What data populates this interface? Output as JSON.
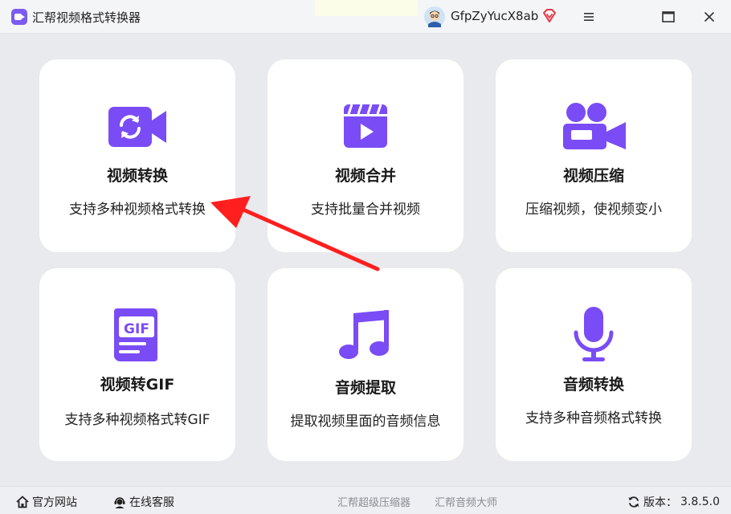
{
  "app": {
    "title": "汇帮视频格式转换器"
  },
  "user": {
    "name": "GfpZyYucX8ab"
  },
  "icons": {
    "app_logo": "video-app-logo",
    "avatar": "cartoon-avatar",
    "vip": "diamond-vip-icon",
    "menu": "hamburger-menu-icon",
    "maximize": "maximize-icon",
    "close": "close-icon"
  },
  "colors": {
    "accent": "#7a4cf5",
    "arrow": "#ff1f1f",
    "vip": "#e53946"
  },
  "cards": [
    {
      "title": "视频转换",
      "desc": "支持多种视频格式转换",
      "icon": "video-convert-icon"
    },
    {
      "title": "视频合并",
      "desc": "支持批量合并视频",
      "icon": "video-merge-icon"
    },
    {
      "title": "视频压缩",
      "desc": "压缩视频，使视频变小",
      "icon": "video-compress-icon"
    },
    {
      "title": "视频转GIF",
      "desc": "支持多种视频格式转GIF",
      "icon": "gif-file-icon"
    },
    {
      "title": "音频提取",
      "desc": "提取视频里面的音频信息",
      "icon": "music-note-icon"
    },
    {
      "title": "音频转换",
      "desc": "支持多种音频格式转换",
      "icon": "microphone-icon"
    }
  ],
  "footer": {
    "website": "官方网站",
    "support": "在线客服",
    "links": [
      "汇帮超级压缩器",
      "汇帮音频大师"
    ],
    "version_label": "版本：",
    "version": "3.8.5.0"
  }
}
